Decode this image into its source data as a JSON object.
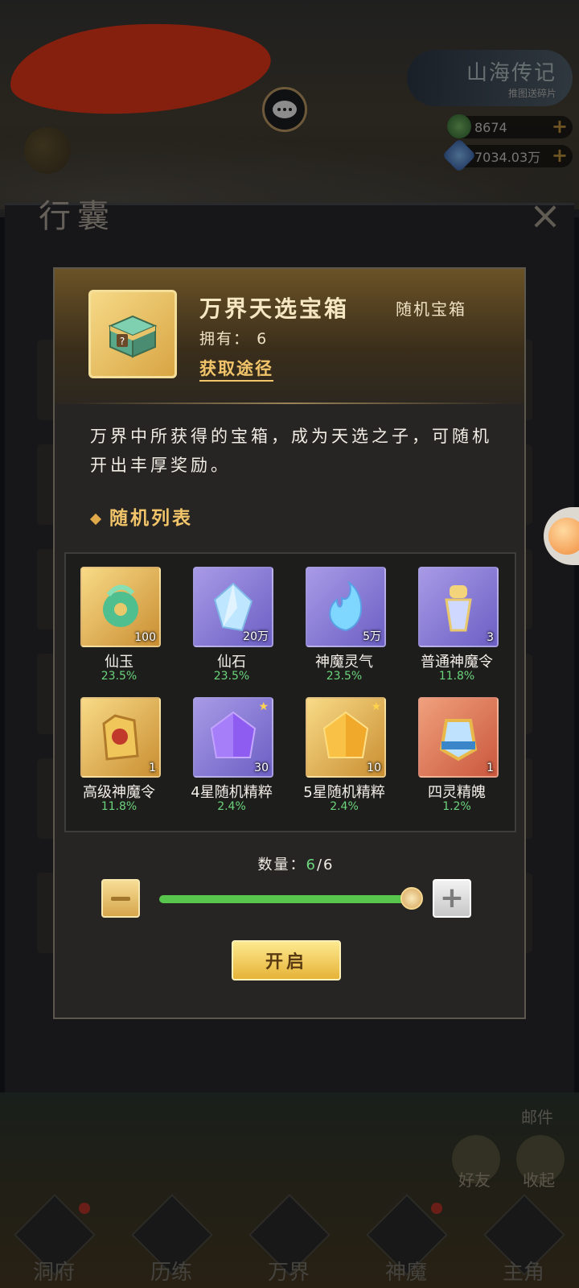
{
  "top_bar": {
    "promo_title": "山海传记",
    "promo_subtitle": "推图送碎片",
    "resource1_value": "8674",
    "resource2_value": "7034.03万"
  },
  "bag": {
    "title": "行囊",
    "close_icon": "×",
    "mail_label": "邮件",
    "side_btn1_label": "好友",
    "side_btn2_label": "收起"
  },
  "nav": [
    {
      "label": "洞府",
      "icon": "house-icon"
    },
    {
      "label": "历练",
      "icon": "mountain-icon"
    },
    {
      "label": "万界",
      "icon": "world-icon"
    },
    {
      "label": "神魔",
      "icon": "demon-icon"
    },
    {
      "label": "主角",
      "icon": "hero-icon"
    }
  ],
  "dialog": {
    "item_name": "万界天选宝箱",
    "item_type": "随机宝箱",
    "owned_label": "拥有：",
    "owned_count": "6",
    "source_link": "获取途径",
    "description": "万界中所获得的宝箱，成为天选之子，可随机开出丰厚奖励。",
    "list_title": "随机列表",
    "rewards": [
      {
        "name": "仙玉",
        "count": "100",
        "prob": "23.5%",
        "bg": "gold"
      },
      {
        "name": "仙石",
        "count": "20万",
        "prob": "23.5%",
        "bg": "purple"
      },
      {
        "name": "神魔灵气",
        "count": "5万",
        "prob": "23.5%",
        "bg": "purple"
      },
      {
        "name": "普通神魔令",
        "count": "3",
        "prob": "11.8%",
        "bg": "purple"
      },
      {
        "name": "高级神魔令",
        "count": "1",
        "prob": "11.8%",
        "bg": "gold"
      },
      {
        "name": "4星随机精粹",
        "count": "30",
        "prob": "2.4%",
        "bg": "purple"
      },
      {
        "name": "5星随机精粹",
        "count": "10",
        "prob": "2.4%",
        "bg": "gold"
      },
      {
        "name": "四灵精魄",
        "count": "1",
        "prob": "1.2%",
        "bg": "red"
      }
    ],
    "quantity_label": "数量：",
    "quantity_current": "6",
    "quantity_max": "/6",
    "quantity_fraction": 1.0,
    "open_button": "开启"
  },
  "colors": {
    "accent_gold": "#f2c56a",
    "prob_green": "#6cd47c",
    "slider_green": "#58c54c"
  }
}
